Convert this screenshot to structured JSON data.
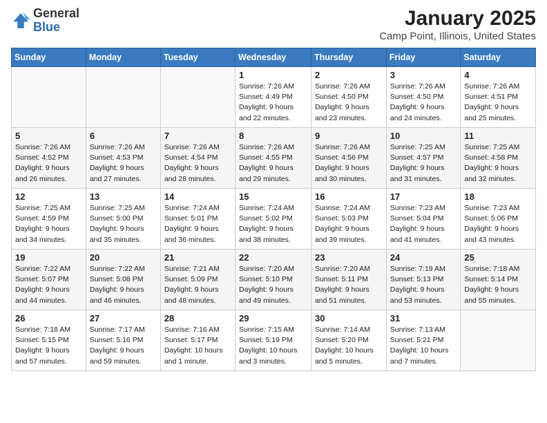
{
  "header": {
    "logo_general": "General",
    "logo_blue": "Blue",
    "title": "January 2025",
    "subtitle": "Camp Point, Illinois, United States"
  },
  "days_of_week": [
    "Sunday",
    "Monday",
    "Tuesday",
    "Wednesday",
    "Thursday",
    "Friday",
    "Saturday"
  ],
  "weeks": [
    [
      {
        "day": "",
        "info": ""
      },
      {
        "day": "",
        "info": ""
      },
      {
        "day": "",
        "info": ""
      },
      {
        "day": "1",
        "info": "Sunrise: 7:26 AM\nSunset: 4:49 PM\nDaylight: 9 hours and 22 minutes."
      },
      {
        "day": "2",
        "info": "Sunrise: 7:26 AM\nSunset: 4:50 PM\nDaylight: 9 hours and 23 minutes."
      },
      {
        "day": "3",
        "info": "Sunrise: 7:26 AM\nSunset: 4:50 PM\nDaylight: 9 hours and 24 minutes."
      },
      {
        "day": "4",
        "info": "Sunrise: 7:26 AM\nSunset: 4:51 PM\nDaylight: 9 hours and 25 minutes."
      }
    ],
    [
      {
        "day": "5",
        "info": "Sunrise: 7:26 AM\nSunset: 4:52 PM\nDaylight: 9 hours and 26 minutes."
      },
      {
        "day": "6",
        "info": "Sunrise: 7:26 AM\nSunset: 4:53 PM\nDaylight: 9 hours and 27 minutes."
      },
      {
        "day": "7",
        "info": "Sunrise: 7:26 AM\nSunset: 4:54 PM\nDaylight: 9 hours and 28 minutes."
      },
      {
        "day": "8",
        "info": "Sunrise: 7:26 AM\nSunset: 4:55 PM\nDaylight: 9 hours and 29 minutes."
      },
      {
        "day": "9",
        "info": "Sunrise: 7:26 AM\nSunset: 4:56 PM\nDaylight: 9 hours and 30 minutes."
      },
      {
        "day": "10",
        "info": "Sunrise: 7:25 AM\nSunset: 4:57 PM\nDaylight: 9 hours and 31 minutes."
      },
      {
        "day": "11",
        "info": "Sunrise: 7:25 AM\nSunset: 4:58 PM\nDaylight: 9 hours and 32 minutes."
      }
    ],
    [
      {
        "day": "12",
        "info": "Sunrise: 7:25 AM\nSunset: 4:59 PM\nDaylight: 9 hours and 34 minutes."
      },
      {
        "day": "13",
        "info": "Sunrise: 7:25 AM\nSunset: 5:00 PM\nDaylight: 9 hours and 35 minutes."
      },
      {
        "day": "14",
        "info": "Sunrise: 7:24 AM\nSunset: 5:01 PM\nDaylight: 9 hours and 36 minutes."
      },
      {
        "day": "15",
        "info": "Sunrise: 7:24 AM\nSunset: 5:02 PM\nDaylight: 9 hours and 38 minutes."
      },
      {
        "day": "16",
        "info": "Sunrise: 7:24 AM\nSunset: 5:03 PM\nDaylight: 9 hours and 39 minutes."
      },
      {
        "day": "17",
        "info": "Sunrise: 7:23 AM\nSunset: 5:04 PM\nDaylight: 9 hours and 41 minutes."
      },
      {
        "day": "18",
        "info": "Sunrise: 7:23 AM\nSunset: 5:06 PM\nDaylight: 9 hours and 43 minutes."
      }
    ],
    [
      {
        "day": "19",
        "info": "Sunrise: 7:22 AM\nSunset: 5:07 PM\nDaylight: 9 hours and 44 minutes."
      },
      {
        "day": "20",
        "info": "Sunrise: 7:22 AM\nSunset: 5:08 PM\nDaylight: 9 hours and 46 minutes."
      },
      {
        "day": "21",
        "info": "Sunrise: 7:21 AM\nSunset: 5:09 PM\nDaylight: 9 hours and 48 minutes."
      },
      {
        "day": "22",
        "info": "Sunrise: 7:20 AM\nSunset: 5:10 PM\nDaylight: 9 hours and 49 minutes."
      },
      {
        "day": "23",
        "info": "Sunrise: 7:20 AM\nSunset: 5:11 PM\nDaylight: 9 hours and 51 minutes."
      },
      {
        "day": "24",
        "info": "Sunrise: 7:19 AM\nSunset: 5:13 PM\nDaylight: 9 hours and 53 minutes."
      },
      {
        "day": "25",
        "info": "Sunrise: 7:18 AM\nSunset: 5:14 PM\nDaylight: 9 hours and 55 minutes."
      }
    ],
    [
      {
        "day": "26",
        "info": "Sunrise: 7:18 AM\nSunset: 5:15 PM\nDaylight: 9 hours and 57 minutes."
      },
      {
        "day": "27",
        "info": "Sunrise: 7:17 AM\nSunset: 5:16 PM\nDaylight: 9 hours and 59 minutes."
      },
      {
        "day": "28",
        "info": "Sunrise: 7:16 AM\nSunset: 5:17 PM\nDaylight: 10 hours and 1 minute."
      },
      {
        "day": "29",
        "info": "Sunrise: 7:15 AM\nSunset: 5:19 PM\nDaylight: 10 hours and 3 minutes."
      },
      {
        "day": "30",
        "info": "Sunrise: 7:14 AM\nSunset: 5:20 PM\nDaylight: 10 hours and 5 minutes."
      },
      {
        "day": "31",
        "info": "Sunrise: 7:13 AM\nSunset: 5:21 PM\nDaylight: 10 hours and 7 minutes."
      },
      {
        "day": "",
        "info": ""
      }
    ]
  ]
}
